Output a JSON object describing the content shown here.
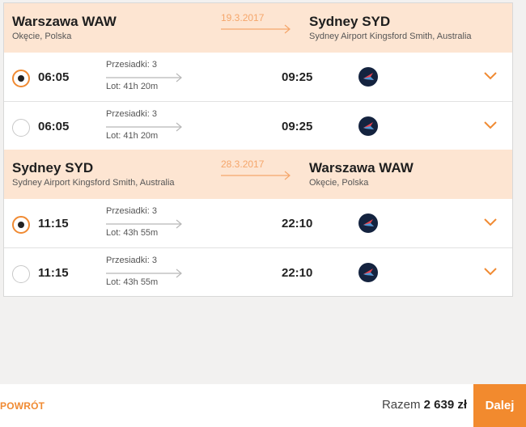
{
  "colors": {
    "accent": "#f08a32",
    "header_bg": "#fde5d2",
    "airline_logo_bg": "#14233f"
  },
  "legs": [
    {
      "from": {
        "city": "Warszawa WAW",
        "airport": "Okęcie, Polska"
      },
      "date": "19.3.2017",
      "to": {
        "city": "Sydney SYD",
        "airport": "Sydney Airport Kingsford Smith, Australia"
      },
      "options": [
        {
          "selected": true,
          "depart": "06:05",
          "stops": "Przesiadki: 3",
          "duration": "Lot: 41h 20m",
          "arrive": "09:25",
          "airline_icon": "airline-logo-icon"
        },
        {
          "selected": false,
          "depart": "06:05",
          "stops": "Przesiadki: 3",
          "duration": "Lot: 41h 20m",
          "arrive": "09:25",
          "airline_icon": "airline-logo-icon"
        }
      ]
    },
    {
      "from": {
        "city": "Sydney SYD",
        "airport": "Sydney Airport Kingsford Smith, Australia"
      },
      "date": "28.3.2017",
      "to": {
        "city": "Warszawa WAW",
        "airport": "Okęcie, Polska"
      },
      "options": [
        {
          "selected": true,
          "depart": "11:15",
          "stops": "Przesiadki: 3",
          "duration": "Lot: 43h 55m",
          "arrive": "22:10",
          "airline_icon": "airline-logo-icon"
        },
        {
          "selected": false,
          "depart": "11:15",
          "stops": "Przesiadki: 3",
          "duration": "Lot: 43h 55m",
          "arrive": "22:10",
          "airline_icon": "airline-logo-icon"
        }
      ]
    }
  ],
  "footer": {
    "back_label": "POWRÓT",
    "total_label": "Razem",
    "total_value": "2 639 zł",
    "next_label": "Dalej"
  }
}
